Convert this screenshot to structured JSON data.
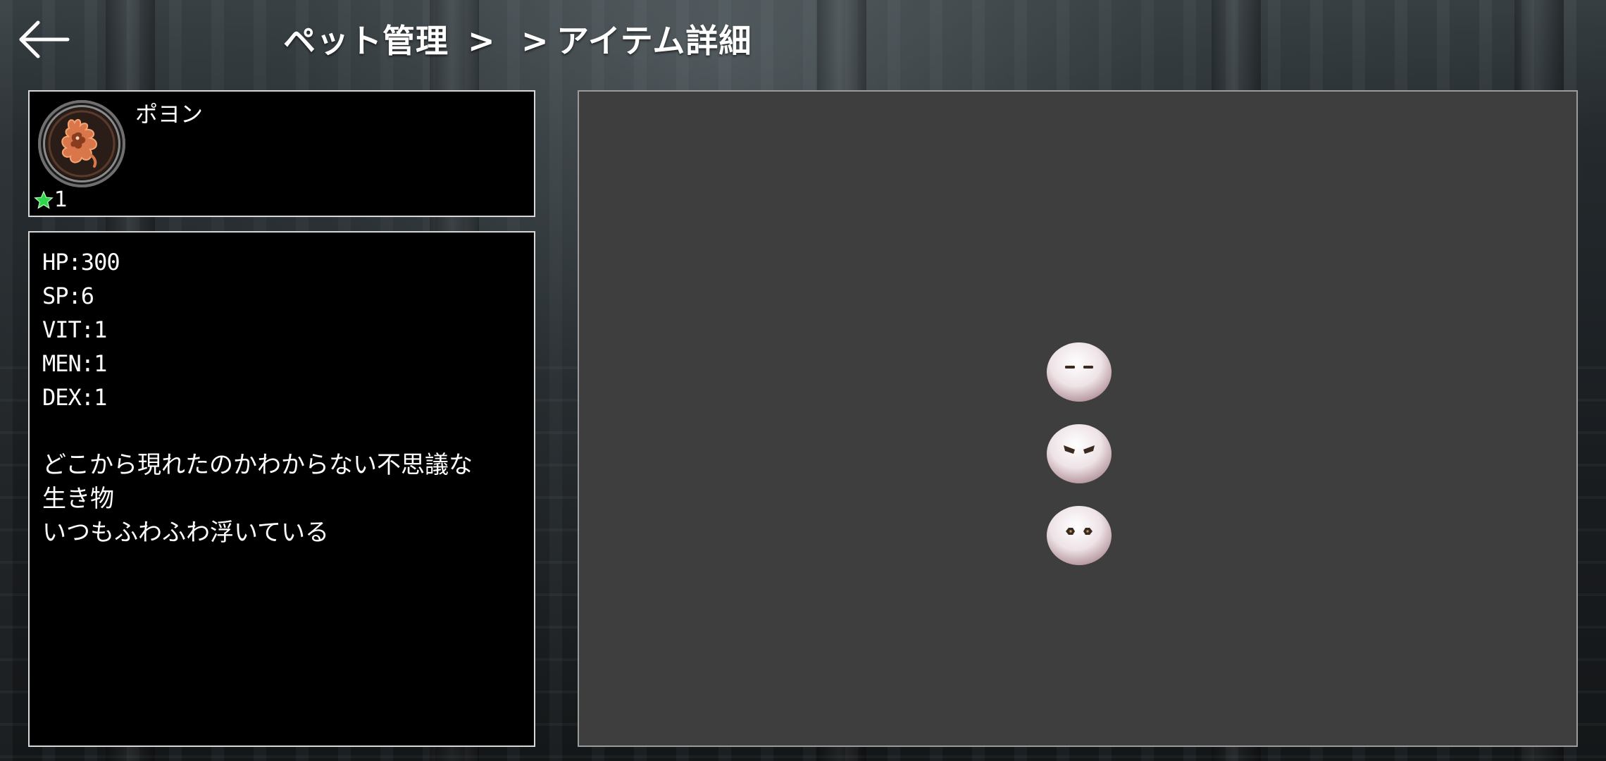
{
  "header": {
    "back_icon": "arrow-left-icon",
    "breadcrumb": [
      {
        "label": "ペット管理"
      },
      {
        "label": ""
      },
      {
        "label": "アイテム詳細"
      }
    ],
    "separator": ">"
  },
  "pet": {
    "name": "ポヨン",
    "avatar_icon": "fox-emblem-icon",
    "rank_icon": "star-icon",
    "rank": "1"
  },
  "details": {
    "stats": [
      "HP:300",
      "SP:6",
      "VIT:1",
      "MEN:1",
      "DEX:1"
    ],
    "description": [
      "どこから現れたのかわからない不思議な",
      "生き物",
      "いつもふわふわ浮いている"
    ]
  },
  "preview": {
    "sprites": [
      {
        "name": "pet-sprite-sleepy"
      },
      {
        "name": "pet-sprite-angry"
      },
      {
        "name": "pet-sprite-surprised"
      }
    ]
  },
  "colors": {
    "panel_bg": "#000000",
    "panel_border": "#d8d8d8",
    "preview_bg": "#3e3e3e",
    "star": "#2fd64a",
    "avatar_accent": "#d9774a"
  }
}
